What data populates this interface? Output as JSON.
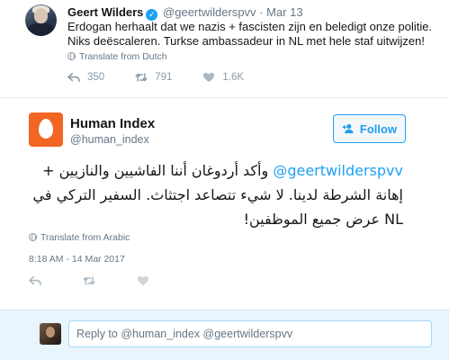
{
  "parent_tweet": {
    "author_name": "Geert Wilders",
    "author_handle": "@geertwilderspvv",
    "separator": "·",
    "timestamp": "Mar 13",
    "text": "Erdogan herhaalt dat we nazis + fascisten zijn en beledigt onze politie. Niks deëscaleren. Turkse ambassadeur in NL met hele staf uitwijzen!",
    "translate_label": "Translate from Dutch",
    "reply_count": "350",
    "retweet_count": "791",
    "like_count": "1.6K"
  },
  "main_tweet": {
    "author_name": "Human Index",
    "author_handle": "@human_index",
    "follow_label": "Follow",
    "mention": "@geertwilderspvv",
    "text_rest": " وأكد أردوغان أننا الفاشيين والنازيين + إهانة الشرطة لدينا. لا شيء تتصاعد اجتثاث. السفير التركي في NL عرض جميع الموظفين!",
    "translate_label": "Translate from Arabic",
    "timestamp": "8:18 AM - 14 Mar 2017"
  },
  "reply_box": {
    "placeholder": "Reply to @human_index @geertwilderspvv"
  },
  "colors": {
    "accent": "#1da1f2",
    "avatar_brand": "#f26522",
    "muted": "#657786",
    "icon_gray": "#8899a6"
  },
  "icons": {
    "verified": "verified-icon",
    "globe": "globe-icon",
    "reply": "reply-icon",
    "retweet": "retweet-icon",
    "like": "heart-icon",
    "follow": "user-plus-icon"
  }
}
